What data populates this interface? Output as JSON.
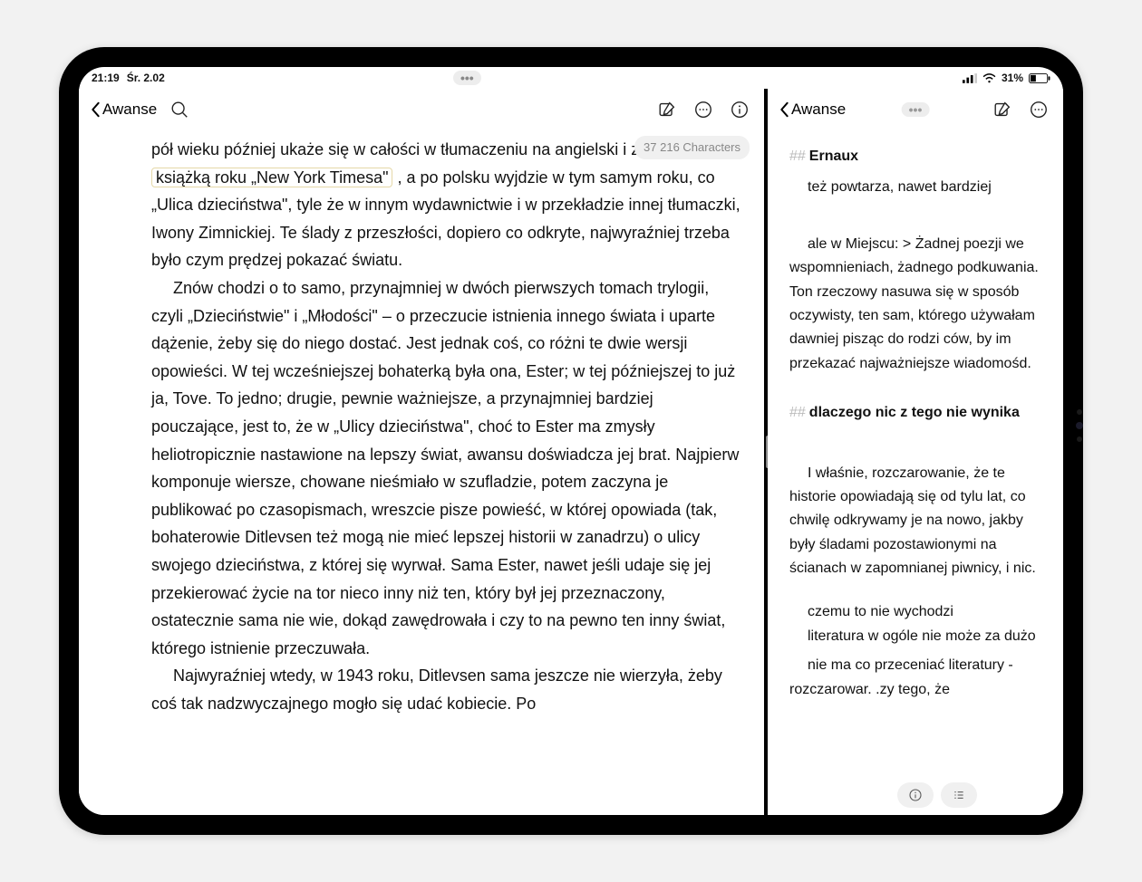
{
  "statusbar": {
    "time": "21:19",
    "date": "Śr. 2.02",
    "battery_pct": "31%"
  },
  "left": {
    "back_label": "Awanse",
    "char_badge": "37 216 Characters",
    "p1_a": "pół wieku później ukaże się w całości w tłumaczeniu na angielski i zostanie ",
    "p1_hl": "książką roku „New York Timesa\"",
    "p1_b": " , a po polsku wyjdzie w tym samym roku, co „Ulica dzieciństwa\", tyle że w innym wydawnictwie i w przekładzie innej tłumaczki, Iwony Zimnickiej. Te ślady z przeszłości, dopiero co odkryte, najwyraźniej trzeba było czym prędzej pokazać światu.",
    "p2": "Znów chodzi o to samo, przynajmniej w dwóch pierwszych tomach trylogii, czyli „Dzieciństwie\" i „Młodości\" – o przeczucie istnienia innego świata i uparte dążenie, żeby się do niego dostać. Jest jednak coś, co różni te dwie wersji opowieści. W tej wcześniejszej bohaterką była ona, Ester; w tej późniejszej to już ja, Tove. To jedno; drugie, pewnie ważniejsze, a przynajmniej bardziej pouczające, jest to, że w „Ulicy dzieciństwa\", choć to Ester ma zmysły heliotropicznie nastawione na lepszy świat, awansu doświadcza jej brat. Najpierw komponuje wiersze, chowane nieśmiało w szufladzie, potem zaczyna je publikować po czasopismach, wreszcie pisze powieść, w której opowiada (tak, bohaterowie Ditlevsen też mogą nie mieć lepszej historii w zanadrzu) o ulicy swojego dzieciństwa, z której się wyrwał. Sama Ester, nawet jeśli udaje się jej przekierować życie na tor nieco inny niż ten, który był jej przeznaczony, ostatecznie sama nie wie, dokąd zawędrowała i czy to na pewno ten inny świat, którego istnienie przeczuwała.",
    "p3": "Najwyraźniej wtedy, w 1943 roku, Ditlevsen sama jeszcze nie wierzyła, żeby coś tak nadzwyczajnego mogło się udać kobiecie. Po"
  },
  "right": {
    "back_label": "Awanse",
    "h1_hash": "##",
    "h1": "Ernaux",
    "n1": "też powtarza, nawet bardziej",
    "n2": "ale w Miejscu: > Żadnej poezji we wspomnieniach, żadnego podkuwa­nia. Ton rzeczowy nasuwa się w sposób oczywisty, ten sam, którego używałam dawniej pisząc do rodzi ców, by im przekazać najważniejsze wiadomośd.",
    "h2_hash": "##",
    "h2": "dlaczego nic z tego nie wynika",
    "n3": "I właśnie, rozczarowanie, że te historie opowiadają się od tylu lat, co chwilę odkrywamy je na nowo, jakby były śladami pozostawionymi na ścianach w zapomnianej piwnicy, i nic.",
    "n4a": "czemu to nie wychodzi",
    "n4b": "literatura w ogóle nie może za dużo",
    "n5": "nie ma co przeceniać literatury - rozczarowar.          .zy tego, że"
  }
}
